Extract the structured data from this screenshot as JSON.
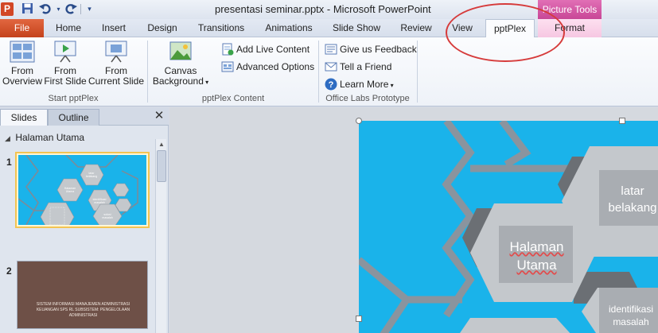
{
  "window": {
    "title": "presentasi seminar.pptx  -  Microsoft PowerPoint",
    "context_tab": "Picture Tools",
    "app_icon_letter": "P"
  },
  "quick_access": {
    "icons": [
      "powerpoint-app-icon",
      "save-icon",
      "undo-icon",
      "redo-icon",
      "customize-qat-icon"
    ]
  },
  "tabs": [
    {
      "label": "File"
    },
    {
      "label": "Home"
    },
    {
      "label": "Insert"
    },
    {
      "label": "Design"
    },
    {
      "label": "Transitions"
    },
    {
      "label": "Animations"
    },
    {
      "label": "Slide Show"
    },
    {
      "label": "Review"
    },
    {
      "label": "View"
    },
    {
      "label": "pptPlex"
    },
    {
      "label": "Format"
    }
  ],
  "active_tab": "pptPlex",
  "annotation": {
    "color": "#d63b3b",
    "shape": "ellipse around pptPlex tab"
  },
  "ribbon": {
    "groups": [
      {
        "label": "Start pptPlex",
        "buttons": [
          {
            "line1": "From",
            "line2": "Overview",
            "icon": "overview-slides-icon"
          },
          {
            "line1": "From",
            "line2": "First Slide",
            "icon": "projector-play-icon"
          },
          {
            "line1": "From",
            "line2": "Current Slide",
            "icon": "projector-current-icon"
          }
        ]
      },
      {
        "label": "pptPlex Content",
        "buttons": [
          {
            "line1": "Canvas",
            "line2": "Background",
            "icon": "canvas-background-icon",
            "dropdown": true
          }
        ],
        "small_buttons": [
          {
            "label": "Add Live Content",
            "icon": "add-live-content-icon"
          },
          {
            "label": "Advanced Options",
            "icon": "advanced-options-icon"
          }
        ]
      },
      {
        "label": "Office Labs Prototype",
        "small_buttons": [
          {
            "label": "Give us Feedback",
            "icon": "feedback-icon"
          },
          {
            "label": "Tell a Friend",
            "icon": "tell-friend-icon"
          },
          {
            "label": "Learn More",
            "icon": "help-icon",
            "dropdown": true
          }
        ]
      }
    ]
  },
  "slides_pane": {
    "tabs": [
      {
        "label": "Slides"
      },
      {
        "label": "Outline"
      }
    ],
    "section": "Halaman Utama",
    "slides": [
      {
        "number": "1",
        "selected": true
      },
      {
        "number": "2",
        "caption": "Sistem informasi manajemen administrasi keuangan SPS RL subsistem: pengelolaan administrasi"
      }
    ]
  },
  "slide_content": {
    "background_color": "#1ab3ea",
    "hexagons": [
      {
        "text": "latar belakang"
      },
      {
        "text": "Halaman Utama"
      },
      {
        "text": "identifikasi masalah"
      }
    ]
  }
}
